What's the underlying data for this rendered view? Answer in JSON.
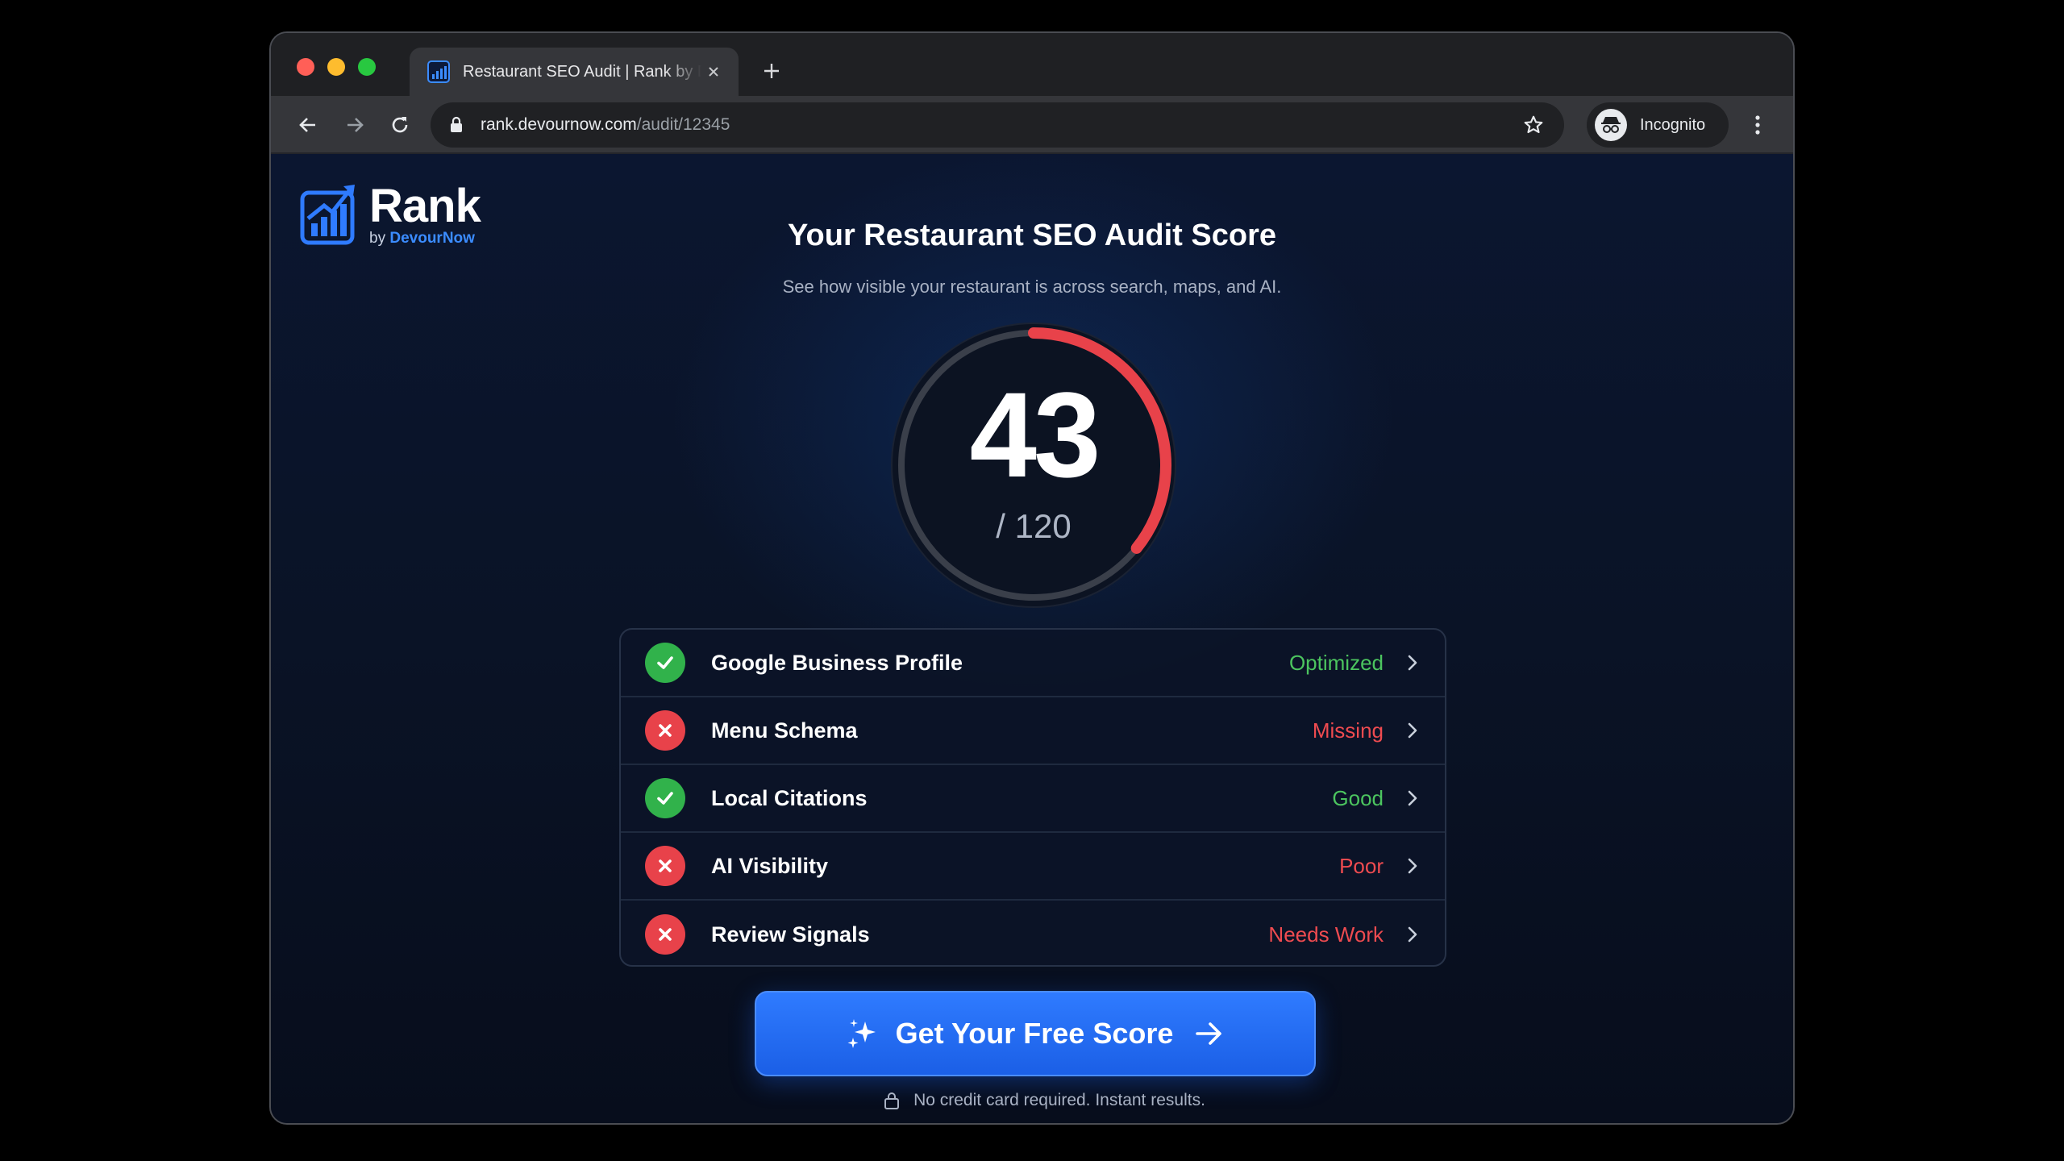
{
  "browser": {
    "tab_title": "Restaurant SEO Audit | Rank by DevourNow",
    "url_host": "rank.devournow.com",
    "url_path": "/audit/12345",
    "profile_label": "Incognito"
  },
  "logo": {
    "word": "Rank",
    "by_prefix": "by",
    "brand": "DevourNow"
  },
  "header": {
    "title": "Your Restaurant SEO Audit Score",
    "subtitle": "See how visible your restaurant is across search, maps, and AI."
  },
  "score": {
    "value": "43",
    "max_label": "/ 120",
    "fraction": 0.358,
    "arc_color": "#e8424a"
  },
  "checks": [
    {
      "label": "Google Business Profile",
      "status": "Optimized",
      "state": "ok"
    },
    {
      "label": "Menu Schema",
      "status": "Missing",
      "state": "bad"
    },
    {
      "label": "Local Citations",
      "status": "Good",
      "state": "ok"
    },
    {
      "label": "AI Visibility",
      "status": "Poor",
      "state": "bad"
    },
    {
      "label": "Review Signals",
      "status": "Needs Work",
      "state": "bad"
    }
  ],
  "cta": {
    "label": "Get Your Free Score",
    "note": "No credit card required. Instant results."
  },
  "icons": {
    "ok": "check-icon",
    "bad": "x-icon",
    "chevron": "chevron-right-icon",
    "spark": "sparkle-icon",
    "arrow": "arrow-right-icon"
  },
  "colors": {
    "accent": "#1b5fe6",
    "ok": "#31b24b",
    "bad": "#e8424a"
  }
}
